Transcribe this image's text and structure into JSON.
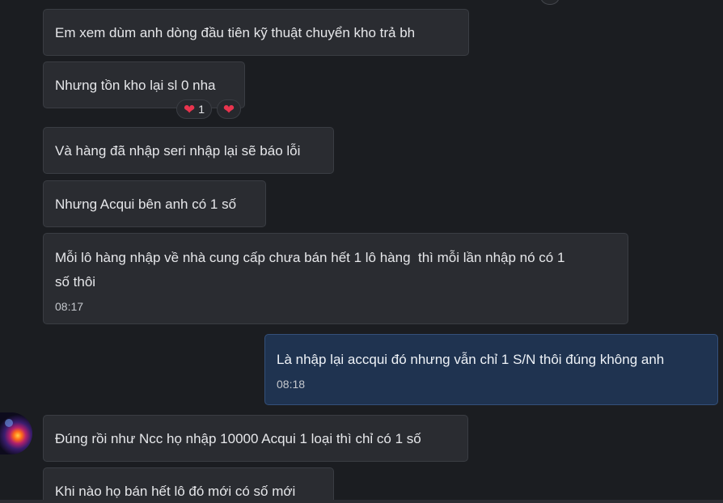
{
  "messages": [
    {
      "text": "Em xem dùm anh dòng đầu tiên kỹ thuật chuyển kho trả bh"
    },
    {
      "text": "Nhưng tồn kho lại sl 0 nha"
    },
    {
      "text": "Và hàng đã nhập seri nhập lại sẽ báo lỗi"
    },
    {
      "text": "Nhưng Acqui bên anh có 1 số"
    },
    {
      "text": "Mỗi lô hàng nhập về nhà cung cấp chưa bán hết 1 lô hàng  thì mỗi lần nhập nó có 1\nsố thôi",
      "time": "08:17"
    },
    {
      "text": "Là nhập lại accqui đó nhưng vẫn chỉ 1 S/N thôi đúng không anh",
      "time": "08:18"
    },
    {
      "text": "Đúng rồi như Ncc họ nhập 10000 Acqui 1 loại thì chỉ có 1 số"
    },
    {
      "text": "Khi nào họ bán hết lô đó mới có số mới"
    }
  ],
  "reactions": [
    {
      "emoji": "❤",
      "count": "1"
    },
    {
      "emoji": "❤"
    }
  ],
  "colors": {
    "background": "#1b1d21",
    "incoming_bubble": "#2a2c31",
    "outgoing_bubble": "#1f3350",
    "heart": "#e8344e"
  }
}
